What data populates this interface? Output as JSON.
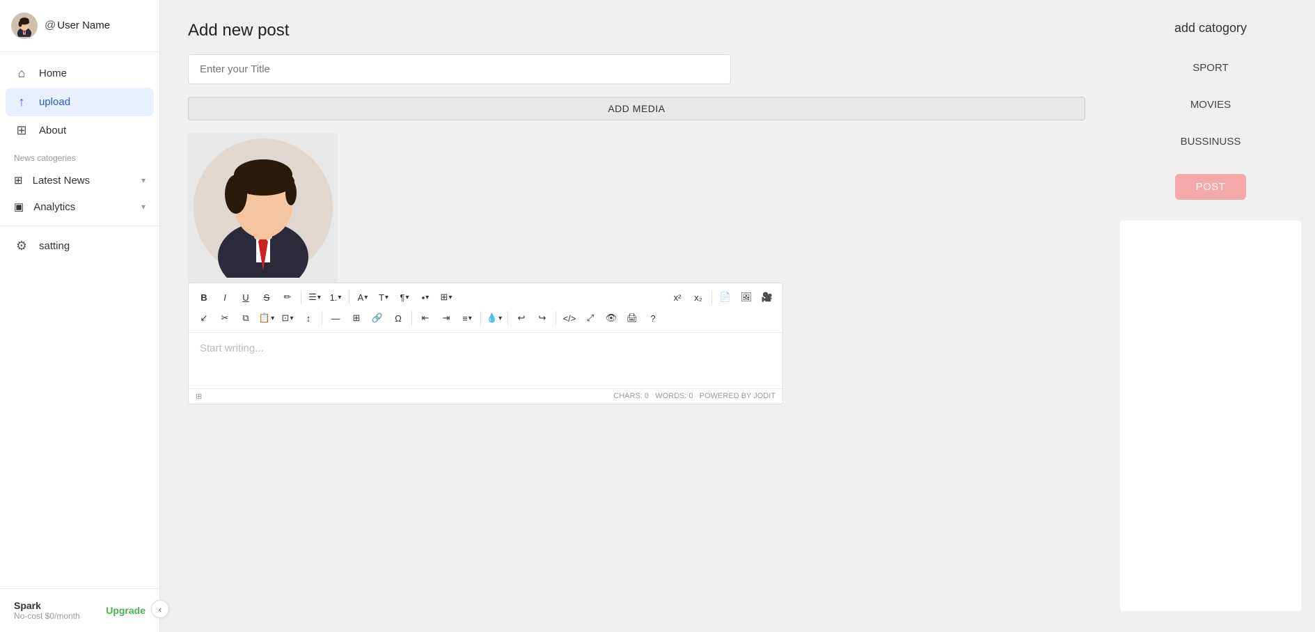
{
  "sidebar": {
    "user": {
      "at_sign": "@",
      "username": "User Name"
    },
    "nav_items": [
      {
        "id": "home",
        "label": "Home",
        "icon": "home"
      },
      {
        "id": "upload",
        "label": "upload",
        "icon": "upload",
        "active": true
      }
    ],
    "about_item": {
      "label": "About",
      "icon": "grid"
    },
    "categories_label": "News catogeries",
    "category_items": [
      {
        "id": "latest-news",
        "label": "Latest News",
        "icon": "table"
      },
      {
        "id": "analytics",
        "label": "Analytics",
        "icon": "monitor"
      }
    ],
    "settings_item": {
      "label": "satting",
      "icon": "gear"
    },
    "plan": {
      "name": "Spark",
      "cost": "No-cost $0/month",
      "upgrade_label": "Upgrade"
    },
    "collapse_icon": "‹"
  },
  "main": {
    "page_title": "Add new post",
    "title_placeholder": "Enter your Title",
    "add_media_label": "ADD MEDIA",
    "editor": {
      "placeholder": "Start writing...",
      "chars_label": "CHARS: 0",
      "words_label": "WORDS: 0",
      "powered_label": "POWERED BY JODIT"
    }
  },
  "right_panel": {
    "add_category_title": "add catogory",
    "categories": [
      {
        "label": "SPORT"
      },
      {
        "label": "MOVIES"
      },
      {
        "label": "BUSSINUSS"
      }
    ],
    "post_button": "POST"
  },
  "toolbar": {
    "row1": [
      "B",
      "I",
      "U",
      "S",
      "✏",
      "≡▾",
      "1.▾",
      "A▾",
      "T▾",
      "¶▾",
      "▪▾",
      "⊞▾",
      "x²",
      "x₂",
      "📄",
      "🖼",
      "🎥"
    ],
    "row2": [
      "↙",
      "✂",
      "⧉",
      "📋▾",
      "⊡▾",
      "↕",
      "—",
      "⊞",
      "🔗",
      "Ω",
      "≡≡",
      "≡≡",
      "≡▾",
      "💧▾",
      "↩",
      "↪",
      "</>",
      "⤢",
      "👁",
      "🖨",
      "?"
    ]
  }
}
